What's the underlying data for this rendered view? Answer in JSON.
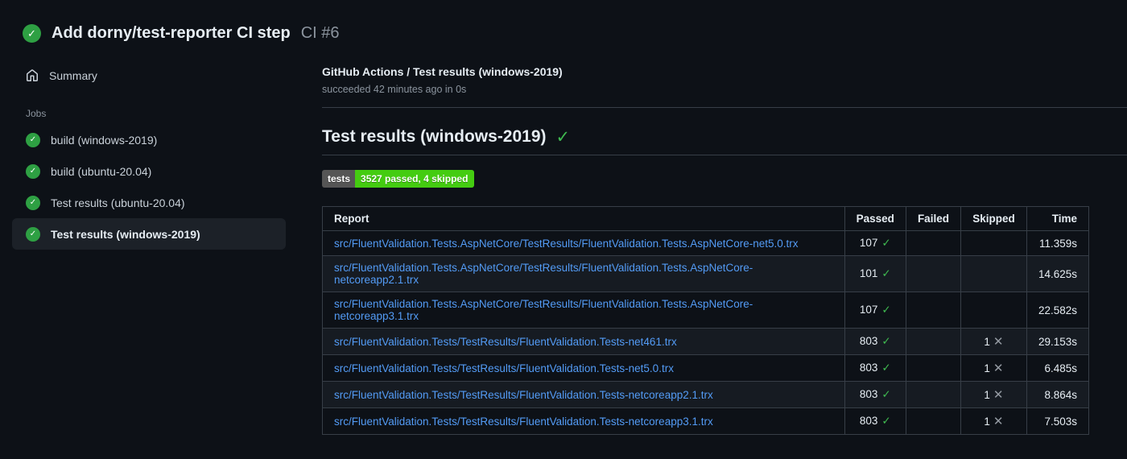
{
  "header": {
    "title": "Add dorny/test-reporter CI step",
    "run_number": "CI #6"
  },
  "sidebar": {
    "summary_label": "Summary",
    "jobs_section_label": "Jobs",
    "jobs": [
      {
        "label": "build (windows-2019)",
        "status": "success",
        "selected": false
      },
      {
        "label": "build (ubuntu-20.04)",
        "status": "success",
        "selected": false
      },
      {
        "label": "Test results (ubuntu-20.04)",
        "status": "success",
        "selected": false
      },
      {
        "label": "Test results (windows-2019)",
        "status": "success",
        "selected": true
      }
    ]
  },
  "main": {
    "breadcrumb": "GitHub Actions / Test results (windows-2019)",
    "status_line": "succeeded 42 minutes ago in 0s",
    "section_title": "Test results (windows-2019)",
    "badge": {
      "label": "tests",
      "value": "3527 passed, 4 skipped"
    },
    "table": {
      "headers": [
        "Report",
        "Passed",
        "Failed",
        "Skipped",
        "Time"
      ],
      "rows": [
        {
          "report": "src/FluentValidation.Tests.AspNetCore/TestResults/FluentValidation.Tests.AspNetCore-net5.0.trx",
          "passed": "107",
          "failed": "",
          "skipped": "",
          "time": "11.359s"
        },
        {
          "report": "src/FluentValidation.Tests.AspNetCore/TestResults/FluentValidation.Tests.AspNetCore-netcoreapp2.1.trx",
          "passed": "101",
          "failed": "",
          "skipped": "",
          "time": "14.625s"
        },
        {
          "report": "src/FluentValidation.Tests.AspNetCore/TestResults/FluentValidation.Tests.AspNetCore-netcoreapp3.1.trx",
          "passed": "107",
          "failed": "",
          "skipped": "",
          "time": "22.582s"
        },
        {
          "report": "src/FluentValidation.Tests/TestResults/FluentValidation.Tests-net461.trx",
          "passed": "803",
          "failed": "",
          "skipped": "1",
          "time": "29.153s"
        },
        {
          "report": "src/FluentValidation.Tests/TestResults/FluentValidation.Tests-net5.0.trx",
          "passed": "803",
          "failed": "",
          "skipped": "1",
          "time": "6.485s"
        },
        {
          "report": "src/FluentValidation.Tests/TestResults/FluentValidation.Tests-netcoreapp2.1.trx",
          "passed": "803",
          "failed": "",
          "skipped": "1",
          "time": "8.864s"
        },
        {
          "report": "src/FluentValidation.Tests/TestResults/FluentValidation.Tests-netcoreapp3.1.trx",
          "passed": "803",
          "failed": "",
          "skipped": "1",
          "time": "7.503s"
        }
      ]
    }
  },
  "icons": {
    "pass_mark": "✓",
    "skip_mark": "✕",
    "status_check": "✓"
  },
  "colors": {
    "background": "#0d1117",
    "row_alt": "#161b22",
    "border": "#373e47",
    "link": "#539bf5",
    "success_green": "#3fb950",
    "status_circle_green": "#2ea043",
    "badge_label_bg": "#555555",
    "badge_value_bg": "#44cc11",
    "muted_text": "#8b949e"
  }
}
